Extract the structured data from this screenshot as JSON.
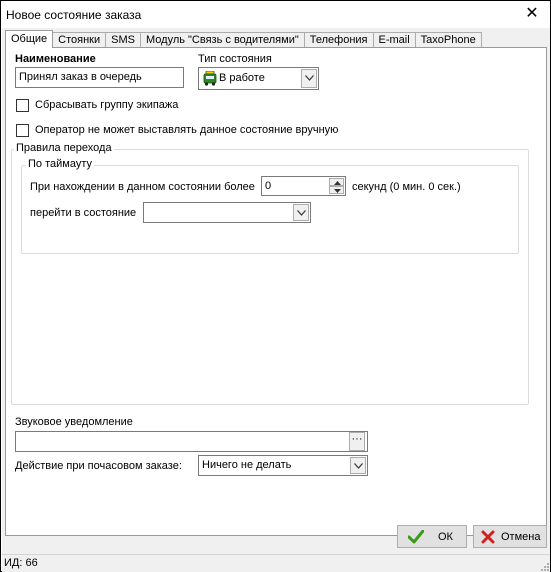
{
  "window": {
    "title": "Новое состояние заказа",
    "close_glyph": "✕"
  },
  "tabs": [
    {
      "label": "Общие",
      "active": true
    },
    {
      "label": "Стоянки"
    },
    {
      "label": "SMS"
    },
    {
      "label": "Модуль \"Связь с водителями\""
    },
    {
      "label": "Телефония"
    },
    {
      "label": "E-mail"
    },
    {
      "label": "TaxoPhone"
    }
  ],
  "general": {
    "name_label": "Наименование",
    "name_value": "Принял заказ в очередь",
    "state_type_label": "Тип состояния",
    "state_type_value": "В работе",
    "state_type_icon": "taxi-car-icon",
    "reset_crew_group_label": "Сбрасывать группу экипажа",
    "reset_crew_group_checked": false,
    "operator_cannot_set_label": "Оператор не может выставлять данное состояние вручную",
    "operator_cannot_set_checked": false
  },
  "transition_rules": {
    "title": "Правила перехода",
    "timeout_group_title": "По таймауту",
    "when_in_state_label": "При нахождении в данном состоянии более",
    "seconds_value": "0",
    "seconds_suffix": "секунд (0 мин. 0 сек.)",
    "go_to_state_label": "перейти в состояние",
    "go_to_state_value": ""
  },
  "sound": {
    "label": "Звуковое уведомление",
    "value": "",
    "browse_label": "···"
  },
  "hourly_order": {
    "label": "Действие при почасовом заказе:",
    "value": "Ничего не делать"
  },
  "buttons": {
    "ok_label": "ОК",
    "cancel_label": "Отмена"
  },
  "status": {
    "id_text": "ИД: 66"
  },
  "colors": {
    "ok_check": "#3a9a1a",
    "cancel_x": "#d02020",
    "border": "#7a7a7a"
  }
}
